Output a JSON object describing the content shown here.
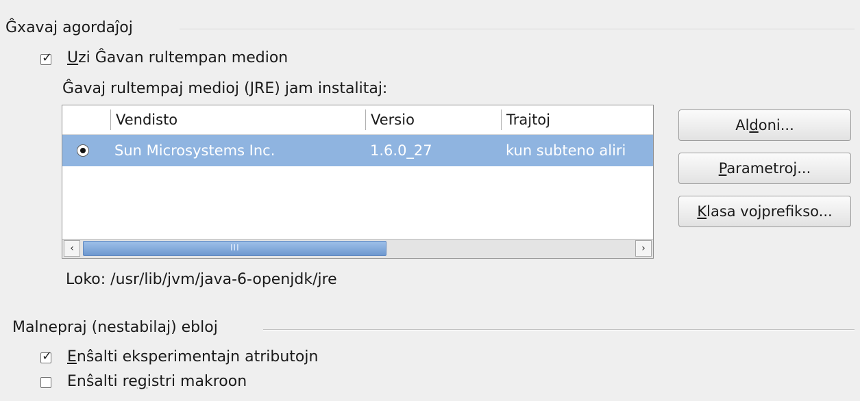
{
  "java": {
    "section_title": "Ĝxavaj agordaĵoj",
    "use_runtime_checkbox": {
      "label_first": "U",
      "label_rest": "zi Ĝavan rultempan medion",
      "checked": true
    },
    "installed_label_a": "Ĝavaj rultempaj medioj (JRE) ",
    "installed_label_j": "j",
    "installed_label_b": "am instalitaj:",
    "table": {
      "headers": [
        "Vendisto",
        "Versio",
        "Trajtoj"
      ],
      "rows": [
        {
          "selected": true,
          "vendor": "Sun Microsystems Inc.",
          "version": "1.6.0_27",
          "features": "kun subteno aliri"
        }
      ],
      "scroll_left": "<",
      "scroll_right": ">",
      "scroll_grip": "III"
    },
    "location_label": "Loko: /usr/lib/jvm/java-6-openjdk/jre",
    "buttons": {
      "add": {
        "pre": "Al",
        "acc": "d",
        "post": "oni..."
      },
      "params": {
        "acc": "P",
        "post": "arametroj..."
      },
      "classpath": {
        "acc": "K",
        "post": "lasa vojprefikso..."
      }
    }
  },
  "optional": {
    "section_title": "Malnepraj (nestabilaj) ebloj",
    "experimental": {
      "acc": "E",
      "post": "nŝalti eksperimentajn atributojn",
      "checked": true
    },
    "macro": {
      "pre": "Enŝalti re",
      "acc": "g",
      "post": "istri makroon",
      "checked": false
    }
  },
  "icons": {
    "checkmark": "✓",
    "chevron_left": "‹",
    "chevron_right": "›"
  }
}
